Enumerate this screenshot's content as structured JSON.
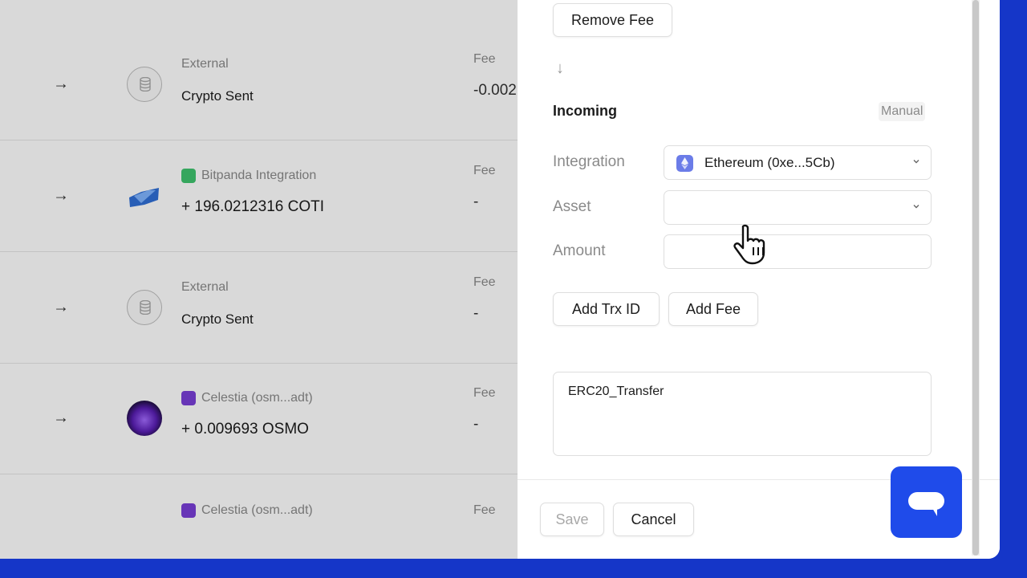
{
  "list": {
    "rows": [
      {
        "label": "External",
        "main": "Crypto Sent",
        "fee_label": "Fee",
        "fee_value": "-0.002"
      },
      {
        "label": "Bitpanda Integration",
        "main": "+ 196.0212316 COTI",
        "fee_label": "Fee",
        "fee_value": "-"
      },
      {
        "label": "External",
        "main": "Crypto Sent",
        "fee_label": "Fee",
        "fee_value": "-"
      },
      {
        "label": "Celestia (osm...adt)",
        "main": "+ 0.009693 OSMO",
        "fee_label": "Fee",
        "fee_value": "-"
      },
      {
        "label": "Celestia (osm...adt)",
        "main": "",
        "fee_label": "Fee",
        "fee_value": ""
      }
    ]
  },
  "panel": {
    "remove_fee_label": "Remove Fee",
    "down_arrow": "↓",
    "section_title": "Incoming",
    "mode_badge": "Manual",
    "integration_label": "Integration",
    "integration_value": "Ethereum (0xe...5Cb)",
    "asset_label": "Asset",
    "asset_value": "",
    "amount_label": "Amount",
    "amount_value": "",
    "add_trx_label": "Add Trx ID",
    "add_fee_label": "Add Fee",
    "note_value": "ERC20_Transfer",
    "save_label": "Save",
    "cancel_label": "Cancel"
  },
  "colors": {
    "accent": "#1f4bea",
    "background_frame": "#1536c8",
    "bitpanda_tag": "#3fc36e",
    "celestia_tag": "#7a3fd8",
    "ethereum_icon": "#6b7ce8"
  },
  "icons": {
    "row_arrow": "arrow-right-icon",
    "external": "database-icon",
    "select": "chevron-down-icon",
    "chat": "chat-bubble-icon",
    "cursor": "hand-pointer-icon"
  }
}
